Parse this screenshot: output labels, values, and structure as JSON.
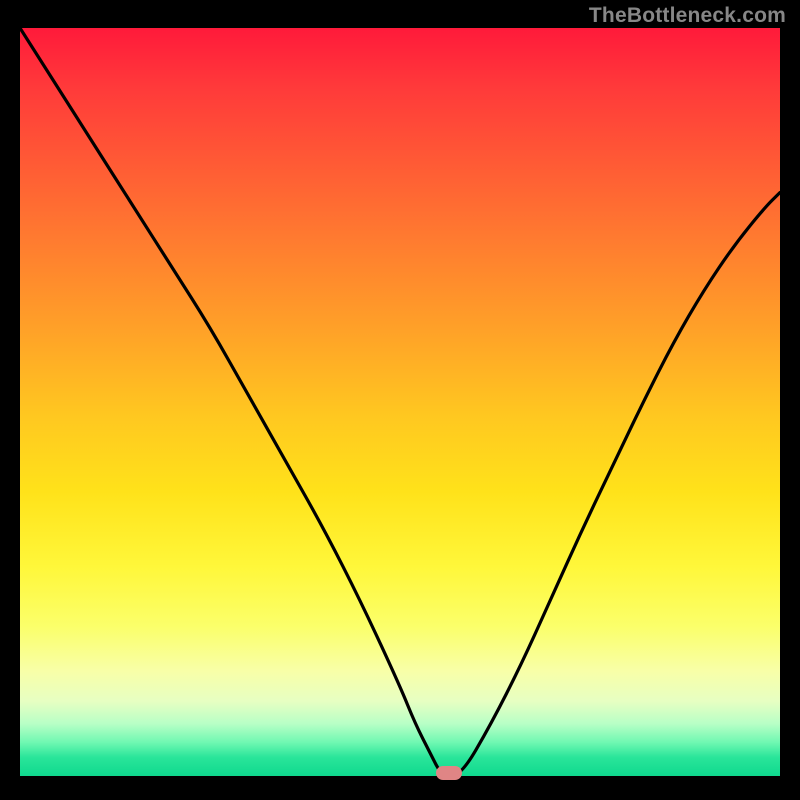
{
  "watermark": "TheBottleneck.com",
  "chart_data": {
    "type": "line",
    "title": "",
    "xlabel": "",
    "ylabel": "",
    "xlim": [
      0,
      100
    ],
    "ylim": [
      0,
      100
    ],
    "series": [
      {
        "name": "bottleneck-curve",
        "x": [
          0,
          5,
          10,
          15,
          20,
          25,
          30,
          35,
          40,
          45,
          50,
          52,
          54,
          55.5,
          58,
          62,
          66,
          70,
          74,
          78,
          82,
          86,
          90,
          94,
          98,
          100
        ],
        "values": [
          100,
          92,
          84,
          76,
          68,
          60,
          51,
          42,
          33,
          23,
          12,
          7,
          3,
          0,
          0,
          7,
          15,
          24,
          33,
          41.5,
          50,
          58,
          65,
          71,
          76,
          78
        ]
      }
    ],
    "background_gradient": {
      "top_color": "#ff1a3a",
      "bottom_color": "#0fd98e",
      "description": "vertical red-to-green gradient"
    },
    "marker": {
      "x": 56.5,
      "y": 0,
      "color": "#e08585",
      "shape": "rounded-rect"
    }
  }
}
